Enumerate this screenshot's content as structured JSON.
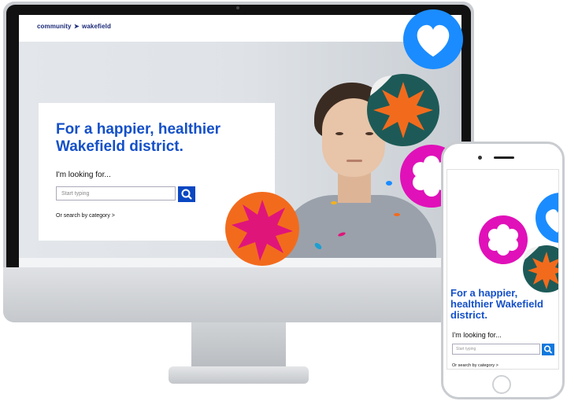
{
  "desktop": {
    "logo": {
      "left": "community",
      "right": "wakefield"
    },
    "hero": {
      "headline": "For a happier, healthier Wakefield district.",
      "looking_label": "I'm looking for...",
      "search_placeholder": "Start typing",
      "category_link": "Or search by category >"
    }
  },
  "mobile": {
    "headline": "For a happier, healthier Wakefield district.",
    "looking_label": "I'm looking for...",
    "search_placeholder": "Start typing",
    "category_link": "Or search by category >"
  },
  "colors": {
    "brand_blue": "#1450c8",
    "search_button": "#0a47c2",
    "sticker_blue": "#1a8cff",
    "sticker_teal": "#1d5a57",
    "sticker_orange": "#f26b1d",
    "sticker_magenta": "#e0119d",
    "sticker_pink": "#e0157a"
  },
  "icons": {
    "search": "search-icon",
    "heart": "heart-icon",
    "starburst": "starburst-icon",
    "flower": "flower-icon"
  }
}
